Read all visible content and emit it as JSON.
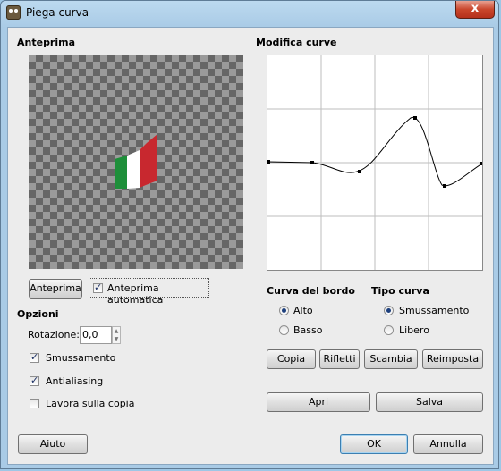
{
  "window": {
    "title": "Piega curva",
    "close_symbol": "x"
  },
  "preview": {
    "heading": "Anteprima",
    "button_label": "Anteprima",
    "auto_preview_label": "Anteprima automatica",
    "auto_preview_checked": true
  },
  "options": {
    "heading": "Opzioni",
    "rotation_label": "Rotazione:",
    "rotation_value": "0,0",
    "smoothing_label": "Smussamento",
    "smoothing_checked": true,
    "antialias_label": "Antialiasing",
    "antialias_checked": true,
    "work_copy_label": "Lavora sulla copia",
    "work_copy_checked": false
  },
  "curves": {
    "heading": "Modifica curve",
    "border_heading": "Curva del bordo",
    "border_options": [
      "Alto",
      "Basso"
    ],
    "border_selected": "Alto",
    "type_heading": "Tipo curva",
    "type_options": [
      "Smussamento",
      "Libero"
    ],
    "type_selected": "Smussamento",
    "buttons": {
      "copy": "Copia",
      "mirror": "Rifletti",
      "swap": "Scambia",
      "reset": "Reimposta",
      "open": "Apri",
      "save": "Salva"
    }
  },
  "footer": {
    "help": "Aiuto",
    "ok": "OK",
    "cancel": "Annulla"
  },
  "colors": {
    "flag_green": "#1e8f3a",
    "flag_white": "#ffffff",
    "flag_red": "#c8282f",
    "accent": "#3c7fb1"
  }
}
